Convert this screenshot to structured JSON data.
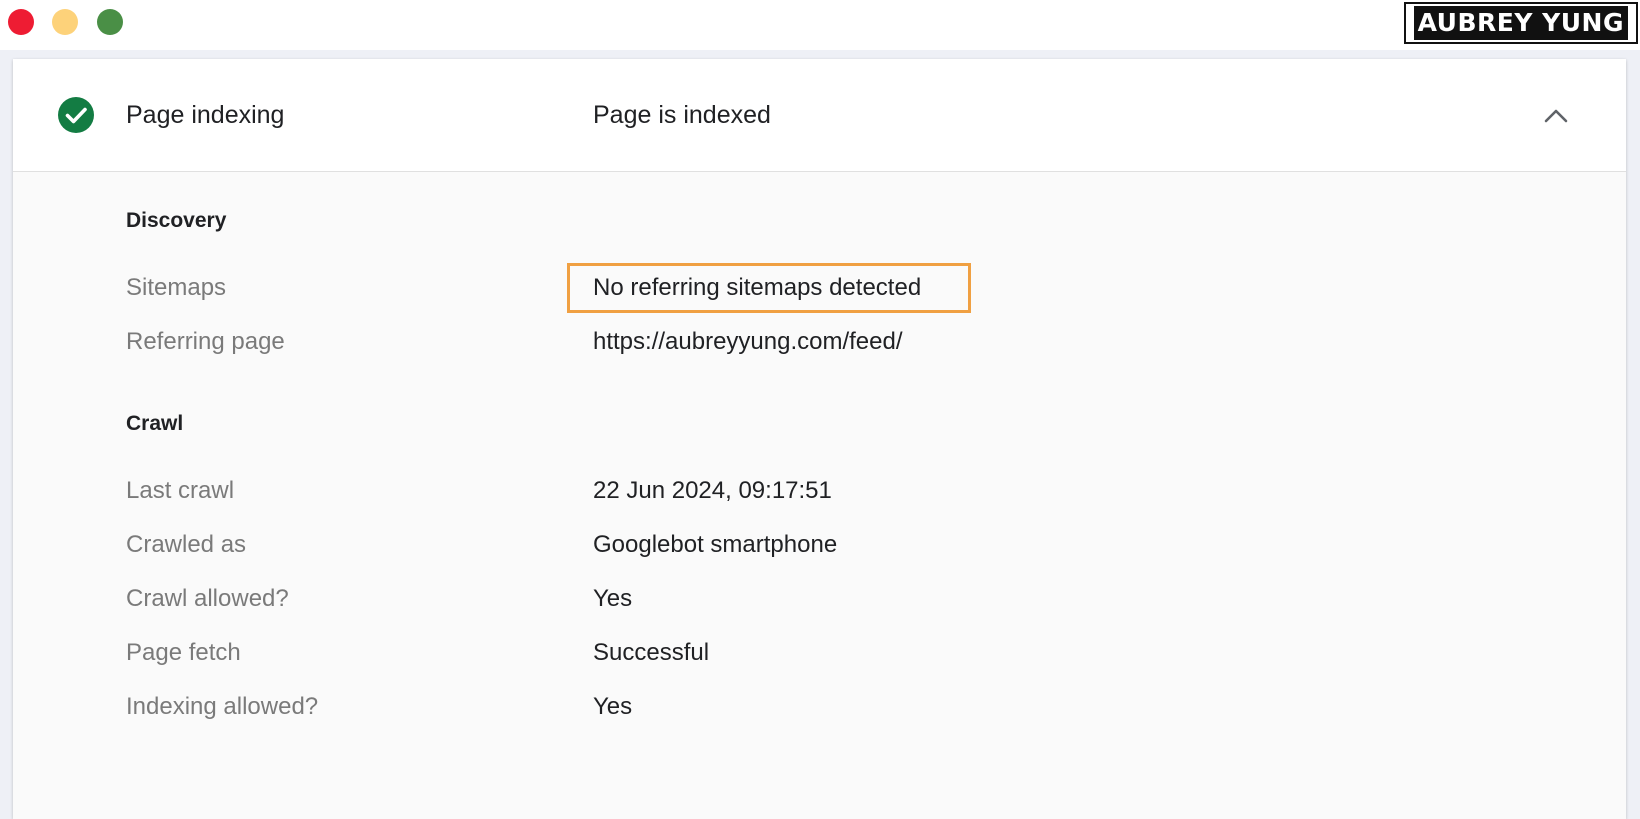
{
  "window": {
    "controls": {
      "close_color": "#ee1c33",
      "minimize_color": "#fdd27a",
      "maximize_color": "#4a8f46"
    },
    "brand": "AUBREY YUNG"
  },
  "card": {
    "header": {
      "icon": "check-circle-icon",
      "icon_color": "#137c43",
      "title": "Page indexing",
      "status": "Page is indexed",
      "toggle_icon": "chevron-up-icon"
    },
    "sections": {
      "discovery": {
        "title": "Discovery",
        "rows": [
          {
            "label": "Sitemaps",
            "value": "No referring sitemaps detected"
          },
          {
            "label": "Referring page",
            "value": "https://aubreyyung.com/feed/"
          }
        ]
      },
      "crawl": {
        "title": "Crawl",
        "rows": [
          {
            "label": "Last crawl",
            "value": "22 Jun 2024, 09:17:51"
          },
          {
            "label": "Crawled as",
            "value": "Googlebot smartphone"
          },
          {
            "label": "Crawl allowed?",
            "value": "Yes"
          },
          {
            "label": "Page fetch",
            "value": "Successful"
          },
          {
            "label": "Indexing allowed?",
            "value": "Yes"
          }
        ]
      }
    },
    "highlight_color": "#f0a042"
  }
}
